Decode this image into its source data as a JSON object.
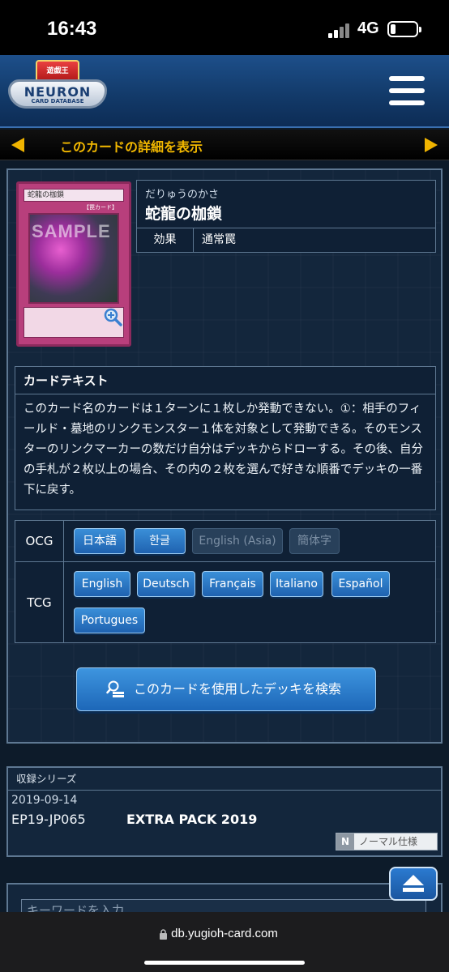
{
  "status": {
    "time": "16:43",
    "network": "4G"
  },
  "header": {
    "logo_top": "遊戯王",
    "logo_main": "NEURON",
    "logo_sub": "CARD DATABASE"
  },
  "titlebar": {
    "title": "このカードの詳細を表示"
  },
  "card": {
    "art_name": "蛇龍の枷鎖",
    "art_type": "【罠カード】",
    "art_sample": "SAMPLE",
    "ruby": "だりゅうのかさ",
    "name": "蛇龍の枷鎖",
    "effect_label": "効果",
    "type": "通常罠"
  },
  "card_text": {
    "heading": "カードテキスト",
    "body": "このカード名のカードは１ターンに１枚しか発動できない。①：相手のフィールド・墓地のリンクモンスター１体を対象として発動できる。そのモンスターのリンクマーカーの数だけ自分はデッキからドローする。その後、自分の手札が２枚以上の場合、その内の２枚を選んで好きな順番でデッキの一番下に戻す。"
  },
  "languages": {
    "ocg_label": "OCG",
    "tcg_label": "TCG",
    "ocg": [
      {
        "label": "日本語",
        "enabled": true
      },
      {
        "label": "한글",
        "enabled": true
      },
      {
        "label": "English (Asia)",
        "enabled": false
      },
      {
        "label": "簡体字",
        "enabled": false
      }
    ],
    "tcg": [
      {
        "label": "English"
      },
      {
        "label": "Deutsch"
      },
      {
        "label": "Français"
      },
      {
        "label": "Italiano"
      },
      {
        "label": "Español"
      },
      {
        "label": "Portugues"
      }
    ]
  },
  "deck_search": {
    "label": "このカードを使用したデッキを検索"
  },
  "series": {
    "heading": "収録シリーズ",
    "release_date": "2019-09-14",
    "card_id": "EP19-JP065",
    "pack_name": "EXTRA PACK 2019",
    "rarity_code": "N",
    "rarity_label": "ノーマル仕様"
  },
  "bottom": {
    "partial_placeholder": "キーワードを入力"
  },
  "address": {
    "url": "db.yugioh-card.com"
  }
}
